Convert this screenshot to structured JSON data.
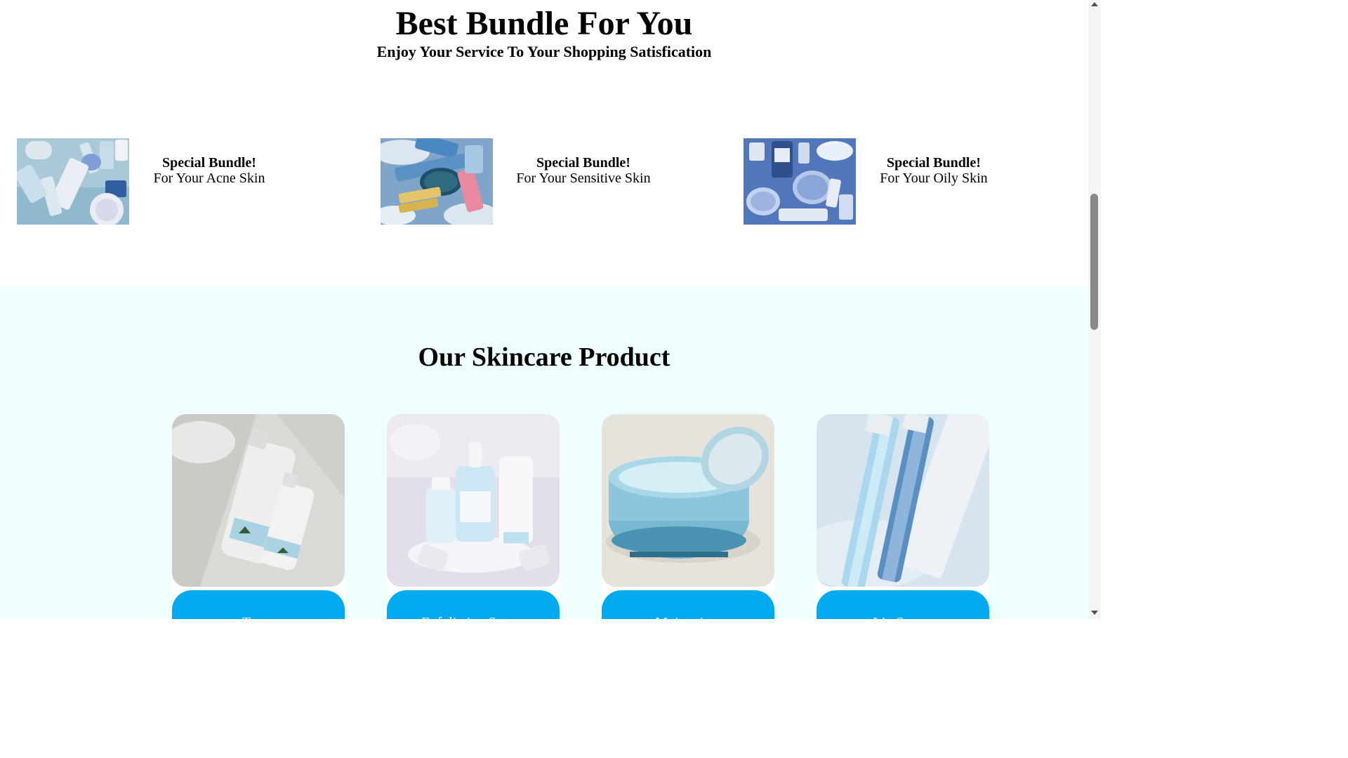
{
  "bundles": {
    "title": "Best Bundle For You",
    "subtitle": "Enjoy Your Service To Your Shopping Satisfication",
    "items": [
      {
        "badge": "Special Bundle!",
        "name": "For Your Acne Skin"
      },
      {
        "badge": "Special Bundle!",
        "name": "For Your Sensitive Skin"
      },
      {
        "badge": "Special Bundle!",
        "name": "For Your Oily Skin"
      }
    ]
  },
  "products": {
    "heading": "Our Skincare Product",
    "items": [
      {
        "button": "Toner"
      },
      {
        "button": "Exfoliating Serum"
      },
      {
        "button": "Moisturizer"
      },
      {
        "button": "Lip Serum"
      }
    ]
  },
  "colors": {
    "product_section_bg": "#effefe",
    "button_bg": "#00aaee",
    "button_text": "#ffffff"
  }
}
